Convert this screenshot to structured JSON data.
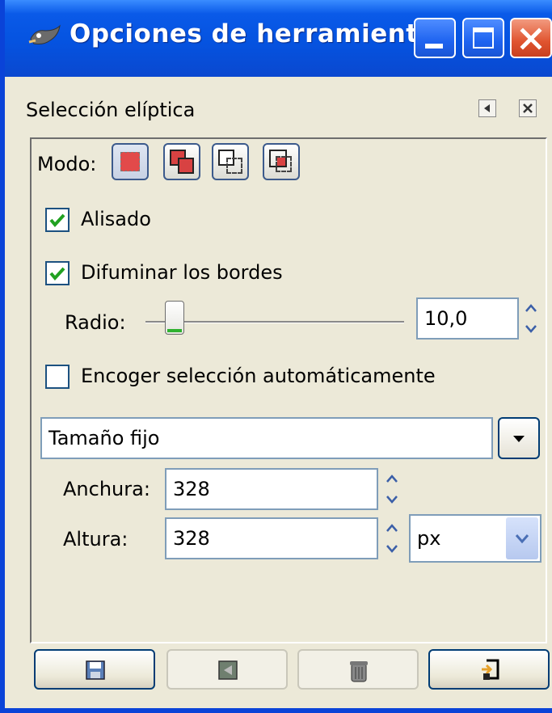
{
  "window": {
    "title": "Opciones de herramienta",
    "colors": {
      "titlebar": "#0553e0",
      "close": "#e0542f",
      "face": "#ece9d8"
    }
  },
  "panel": {
    "title": "Selección elíptica"
  },
  "mode": {
    "label": "Modo:",
    "buttons": [
      "replace-selection",
      "add-to-selection",
      "subtract-from-selection",
      "intersect-with-selection"
    ]
  },
  "antialias": {
    "label": "Alisado",
    "checked": true
  },
  "feather": {
    "label": "Difuminar los bordes",
    "checked": true,
    "radius_label": "Radio:",
    "radius_value": "10,0"
  },
  "auto_shrink": {
    "label": "Encoger selección automáticamente",
    "checked": false
  },
  "fixed": {
    "mode_value": "Tamaño fijo",
    "width_label": "Anchura:",
    "width_value": "328",
    "height_label": "Altura:",
    "height_value": "328",
    "unit_value": "px"
  },
  "bottom_buttons": [
    "save-icon",
    "restore-icon",
    "delete-icon",
    "reset-icon"
  ]
}
